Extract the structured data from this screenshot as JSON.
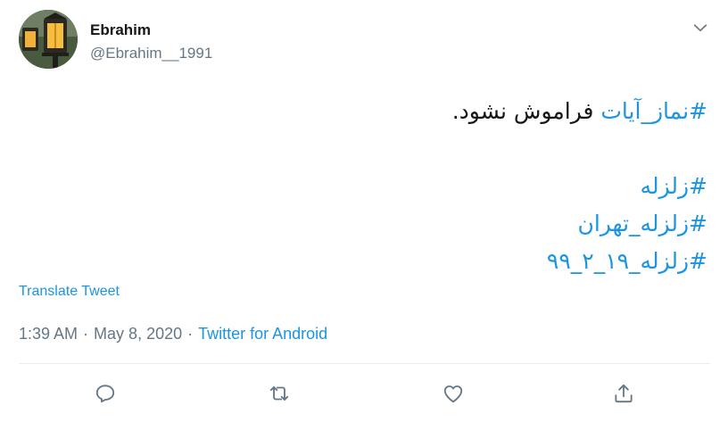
{
  "author": {
    "display_name": "Ebrahim",
    "handle": "@Ebrahim__1991",
    "avatar_icon": "street-lantern-avatar"
  },
  "menu_icon": "chevron-down-icon",
  "tweet": {
    "line1_hashtag": "#نماز_آیات",
    "line1_text": " فراموش نشود.",
    "hashtags": [
      "#زلزله",
      "#زلزله_تهران",
      "#زلزله_۱۹_۲_۹۹"
    ]
  },
  "translate_label": "Translate Tweet",
  "meta": {
    "time": "1:39 AM",
    "date": "May 8, 2020",
    "separator": "·",
    "source": "Twitter for Android"
  },
  "actions": [
    "reply-icon",
    "retweet-icon",
    "like-icon",
    "share-icon"
  ],
  "colors": {
    "link": "#1b95e0",
    "muted": "#657786",
    "text": "#14171a",
    "divider": "#e6ecf0"
  }
}
